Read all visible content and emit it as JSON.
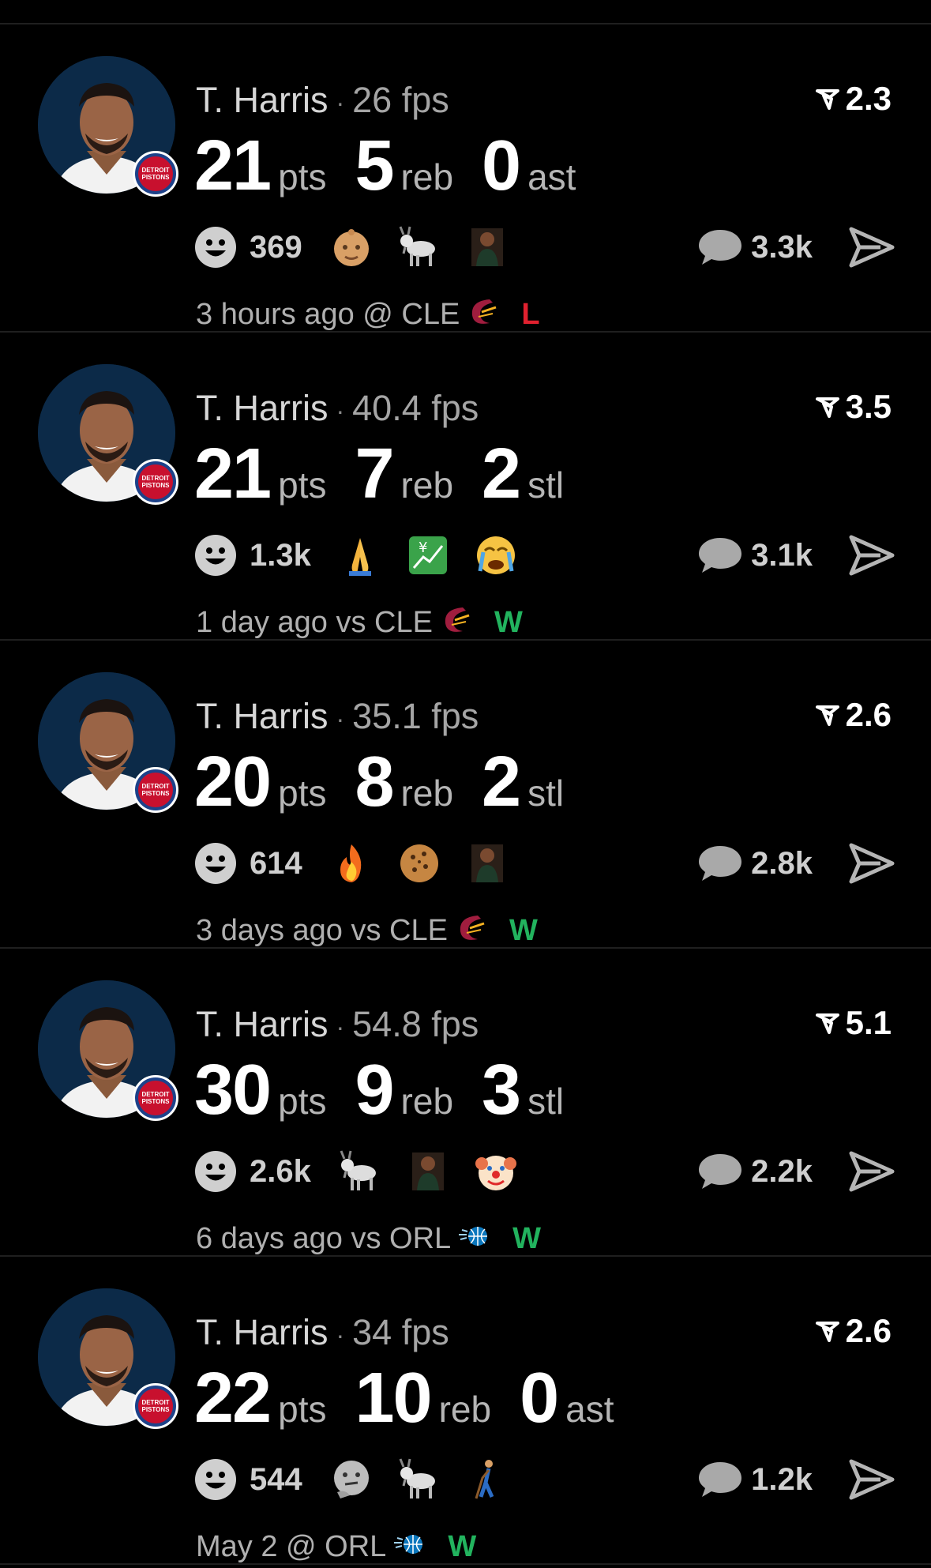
{
  "colors": {
    "background": "#000000",
    "divider": "#1f1f1f",
    "win": "#22b35e",
    "loss": "#e0212f",
    "cavs": "#a01d3e",
    "magic": "#0b77bd"
  },
  "posts": [
    {
      "player": "T. Harris",
      "fps": "26 fps",
      "rating": "2.3",
      "stats": [
        {
          "num": "21",
          "unit": "pts"
        },
        {
          "num": "5",
          "unit": "reb"
        },
        {
          "num": "0",
          "unit": "ast"
        }
      ],
      "reaction_count": "369",
      "reaction_emojis": [
        "baby-face-icon",
        "goat-icon",
        "player-photo-icon"
      ],
      "comment_count": "3.3k",
      "meta": "3 hours ago @ CLE",
      "team_logo": "cavaliers-logo-icon",
      "result": "L",
      "result_type": "loss"
    },
    {
      "player": "T. Harris",
      "fps": "40.4 fps",
      "rating": "3.5",
      "stats": [
        {
          "num": "21",
          "unit": "pts"
        },
        {
          "num": "7",
          "unit": "reb"
        },
        {
          "num": "2",
          "unit": "stl"
        }
      ],
      "reaction_count": "1.3k",
      "reaction_emojis": [
        "folded-hands-icon",
        "chart-yen-icon",
        "crying-face-icon"
      ],
      "comment_count": "3.1k",
      "meta": "1 day ago vs CLE",
      "team_logo": "cavaliers-logo-icon",
      "result": "W",
      "result_type": "win"
    },
    {
      "player": "T. Harris",
      "fps": "35.1 fps",
      "rating": "2.6",
      "stats": [
        {
          "num": "20",
          "unit": "pts"
        },
        {
          "num": "8",
          "unit": "reb"
        },
        {
          "num": "2",
          "unit": "stl"
        }
      ],
      "reaction_count": "614",
      "reaction_emojis": [
        "fire-icon",
        "cookie-icon",
        "player-photo-icon"
      ],
      "comment_count": "2.8k",
      "meta": "3 days ago vs CLE",
      "team_logo": "cavaliers-logo-icon",
      "result": "W",
      "result_type": "win"
    },
    {
      "player": "T. Harris",
      "fps": "54.8 fps",
      "rating": "5.1",
      "stats": [
        {
          "num": "30",
          "unit": "pts"
        },
        {
          "num": "9",
          "unit": "reb"
        },
        {
          "num": "3",
          "unit": "stl"
        }
      ],
      "reaction_count": "2.6k",
      "reaction_emojis": [
        "goat-icon",
        "player-photo-icon",
        "clown-face-icon"
      ],
      "comment_count": "2.2k",
      "meta": "6 days ago vs ORL",
      "team_logo": "magic-logo-icon",
      "result": "W",
      "result_type": "win"
    },
    {
      "player": "T. Harris",
      "fps": "34 fps",
      "rating": "2.6",
      "stats": [
        {
          "num": "22",
          "unit": "pts"
        },
        {
          "num": "10",
          "unit": "reb"
        },
        {
          "num": "0",
          "unit": "ast"
        }
      ],
      "reaction_count": "544",
      "reaction_emojis": [
        "thinking-face-icon",
        "goat-icon",
        "person-with-cane-icon"
      ],
      "comment_count": "1.2k",
      "meta": "May 2 @ ORL",
      "team_logo": "magic-logo-icon",
      "result": "W",
      "result_type": "win"
    }
  ]
}
